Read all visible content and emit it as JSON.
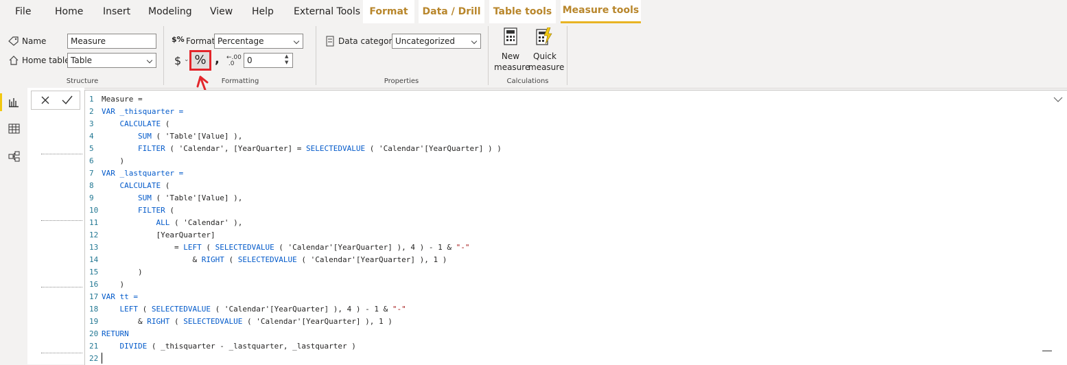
{
  "menu": {
    "tabs": [
      "File",
      "Home",
      "Insert",
      "Modeling",
      "View",
      "Help",
      "External Tools"
    ],
    "context_tabs": [
      "Format",
      "Data / Drill",
      "Table tools",
      "Measure tools"
    ],
    "active_tab": "Measure tools"
  },
  "structure": {
    "name_label": "Name",
    "name_value": "Measure",
    "home_table_label": "Home table",
    "home_table_value": "Table",
    "group_label": "Structure"
  },
  "formatting": {
    "format_label": "Format",
    "format_value": "Percentage",
    "currency_symbol": "$",
    "percent_symbol": "%",
    "comma_symbol": ",",
    "decimal_value": "0",
    "group_label": "Formatting",
    "highlight_color": "#e3262b"
  },
  "properties": {
    "data_category_label": "Data category",
    "data_category_value": "Uncategorized",
    "group_label": "Properties"
  },
  "calculations": {
    "new_measure_line1": "New",
    "new_measure_line2": "measure",
    "quick_measure_line1": "Quick",
    "quick_measure_line2": "measure",
    "group_label": "Calculations"
  },
  "code": {
    "lines": [
      [
        {
          "t": "Measure ="
        }
      ],
      [
        {
          "t": "VAR _thisquarter =",
          "c": "kw"
        }
      ],
      [
        {
          "t": "    "
        },
        {
          "t": "CALCULATE",
          "c": "fn"
        },
        {
          "t": " ("
        }
      ],
      [
        {
          "t": "        "
        },
        {
          "t": "SUM",
          "c": "fn"
        },
        {
          "t": " ( 'Table'[Value] ),"
        }
      ],
      [
        {
          "t": "        "
        },
        {
          "t": "FILTER",
          "c": "fn"
        },
        {
          "t": " ( 'Calendar', [YearQuarter] = "
        },
        {
          "t": "SELECTEDVALUE",
          "c": "fn"
        },
        {
          "t": " ( 'Calendar'[YearQuarter] ) )"
        }
      ],
      [
        {
          "t": "    )"
        }
      ],
      [
        {
          "t": "VAR _lastquarter =",
          "c": "kw"
        }
      ],
      [
        {
          "t": "    "
        },
        {
          "t": "CALCULATE",
          "c": "fn"
        },
        {
          "t": " ("
        }
      ],
      [
        {
          "t": "        "
        },
        {
          "t": "SUM",
          "c": "fn"
        },
        {
          "t": " ( 'Table'[Value] ),"
        }
      ],
      [
        {
          "t": "        "
        },
        {
          "t": "FILTER",
          "c": "fn"
        },
        {
          "t": " ("
        }
      ],
      [
        {
          "t": "            "
        },
        {
          "t": "ALL",
          "c": "fn"
        },
        {
          "t": " ( 'Calendar' ),"
        }
      ],
      [
        {
          "t": "            [YearQuarter]"
        }
      ],
      [
        {
          "t": "                = "
        },
        {
          "t": "LEFT",
          "c": "fn"
        },
        {
          "t": " ( "
        },
        {
          "t": "SELECTEDVALUE",
          "c": "fn"
        },
        {
          "t": " ( 'Calendar'[YearQuarter] ), 4 ) - 1 & "
        },
        {
          "t": "\"-\"",
          "c": "str"
        }
      ],
      [
        {
          "t": "                    & "
        },
        {
          "t": "RIGHT",
          "c": "fn"
        },
        {
          "t": " ( "
        },
        {
          "t": "SELECTEDVALUE",
          "c": "fn"
        },
        {
          "t": " ( 'Calendar'[YearQuarter] ), 1 )"
        }
      ],
      [
        {
          "t": "        )"
        }
      ],
      [
        {
          "t": "    )"
        }
      ],
      [
        {
          "t": "VAR tt =",
          "c": "kw"
        }
      ],
      [
        {
          "t": "    "
        },
        {
          "t": "LEFT",
          "c": "fn"
        },
        {
          "t": " ( "
        },
        {
          "t": "SELECTEDVALUE",
          "c": "fn"
        },
        {
          "t": " ( 'Calendar'[YearQuarter] ), 4 ) - 1 & "
        },
        {
          "t": "\"-\"",
          "c": "str"
        }
      ],
      [
        {
          "t": "        & "
        },
        {
          "t": "RIGHT",
          "c": "fn"
        },
        {
          "t": " ( "
        },
        {
          "t": "SELECTEDVALUE",
          "c": "fn"
        },
        {
          "t": " ( 'Calendar'[YearQuarter] ), 1 )"
        }
      ],
      [
        {
          "t": "RETURN",
          "c": "kw"
        }
      ],
      [
        {
          "t": "    "
        },
        {
          "t": "DIVIDE",
          "c": "fn"
        },
        {
          "t": " ( _thisquarter - _lastquarter, _lastquarter )"
        }
      ],
      [
        {
          "t": ""
        }
      ]
    ]
  }
}
